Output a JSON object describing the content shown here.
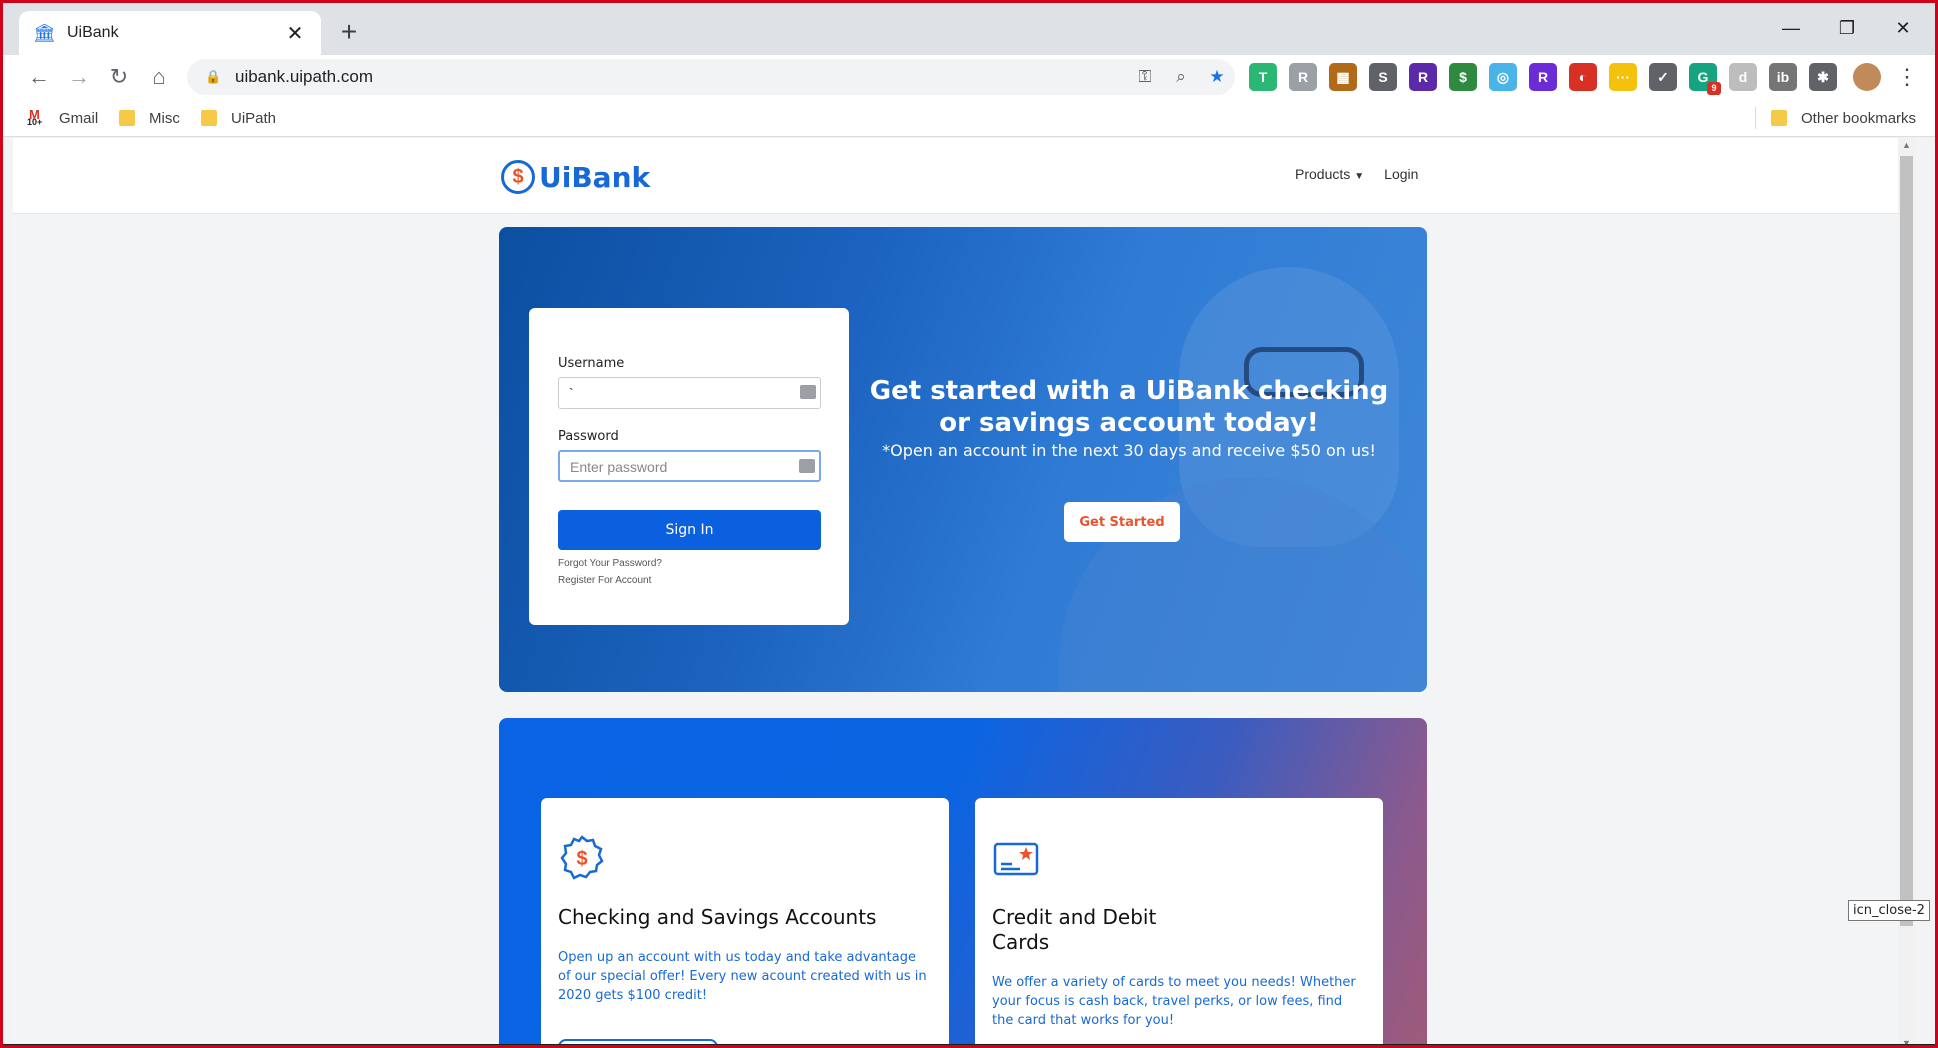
{
  "browser": {
    "tab_title": "UiBank",
    "new_tab": "+",
    "tab_close": "✕",
    "url": "uibank.uipath.com",
    "window_minimize": "—",
    "window_restore": "❐",
    "window_close": "✕"
  },
  "extensions": [
    {
      "name": "T",
      "color": "#2bb673"
    },
    {
      "name": "R",
      "color": "#9aa0a6"
    },
    {
      "name": "▦",
      "color": "#b06a1a"
    },
    {
      "name": "S",
      "color": "#5f6368"
    },
    {
      "name": "R",
      "color": "#5b2aa8"
    },
    {
      "name": "$",
      "color": "#2d8a3e"
    },
    {
      "name": "◎",
      "color": "#4ab3e8"
    },
    {
      "name": "R",
      "color": "#6b2bd6"
    },
    {
      "name": "◐",
      "color": "#d93025"
    },
    {
      "name": "···",
      "color": "#f4c20d"
    },
    {
      "name": "✓",
      "color": "#5f6368"
    },
    {
      "name": "G",
      "color": "#16a37f",
      "badge": "9"
    },
    {
      "name": "d",
      "color": "#bdbdbd"
    },
    {
      "name": "ib",
      "color": "#757575"
    },
    {
      "name": "✱",
      "color": "#5f6368"
    }
  ],
  "bookmarks": {
    "gmail": "Gmail",
    "gmail_badge": "10+",
    "misc": "Misc",
    "uipath": "UiPath",
    "other": "Other bookmarks"
  },
  "site": {
    "logo_text": "UiBank",
    "logo_symbol": "$",
    "nav_products": "Products",
    "nav_login": "Login"
  },
  "login": {
    "username_label": "Username",
    "username_value": "`",
    "password_label": "Password",
    "password_placeholder": "Enter password",
    "signin_label": "Sign In",
    "forgot_link": "Forgot Your Password?",
    "register_link": "Register For Account"
  },
  "hero": {
    "title": "Get started with a UiBank checking or savings account today!",
    "subtitle": "*Open an account in the next 30 days and receive $50 on us!",
    "cta": "Get Started"
  },
  "products": [
    {
      "title": "Checking and Savings Accounts",
      "text": "Open up an account with us today and take advantage of our special offer! Every new acount created with us in 2020 gets $100 credit!"
    },
    {
      "title": "Credit and Debit Cards",
      "text": "We offer a variety of cards to meet you needs! Whether your focus is cash back, travel perks, or low fees, find the card that works for you!"
    }
  ],
  "tooltip": "icn_close-2",
  "colors": {
    "brand_blue": "#1769d6",
    "accent_orange": "#e8542c",
    "signin_blue": "#0b60e0"
  }
}
